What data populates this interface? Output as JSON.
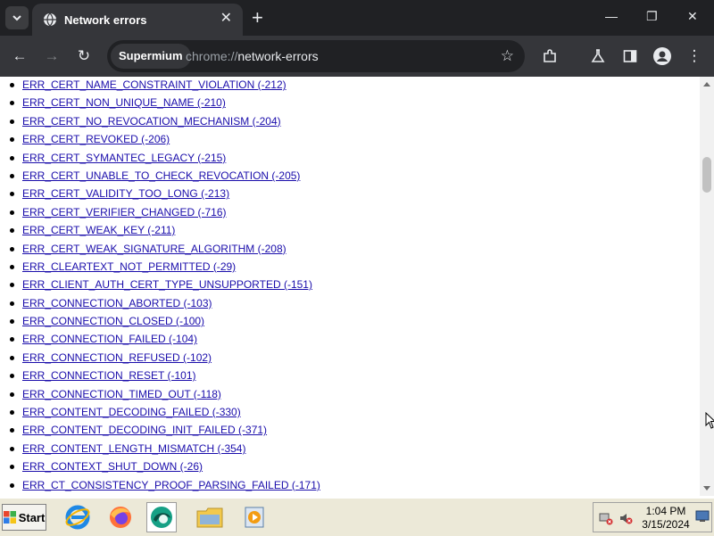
{
  "tab": {
    "title": "Network errors",
    "close_glyph": "✕"
  },
  "window": {
    "minimize_glyph": "—",
    "restore_glyph": "❐",
    "close_glyph": "✕",
    "new_tab_glyph": "+"
  },
  "toolbar": {
    "back_glyph": "←",
    "forward_glyph": "→",
    "reload_glyph": "↻",
    "site_chip": "Supermium",
    "url_scheme": "chrome://",
    "url_host": "network-errors",
    "bookmark_glyph": "☆",
    "menu_glyph": "⋮"
  },
  "errors": [
    "ERR_CERT_NAME_CONSTRAINT_VIOLATION (-212)",
    "ERR_CERT_NON_UNIQUE_NAME (-210)",
    "ERR_CERT_NO_REVOCATION_MECHANISM (-204)",
    "ERR_CERT_REVOKED (-206)",
    "ERR_CERT_SYMANTEC_LEGACY (-215)",
    "ERR_CERT_UNABLE_TO_CHECK_REVOCATION (-205)",
    "ERR_CERT_VALIDITY_TOO_LONG (-213)",
    "ERR_CERT_VERIFIER_CHANGED (-716)",
    "ERR_CERT_WEAK_KEY (-211)",
    "ERR_CERT_WEAK_SIGNATURE_ALGORITHM (-208)",
    "ERR_CLEARTEXT_NOT_PERMITTED (-29)",
    "ERR_CLIENT_AUTH_CERT_TYPE_UNSUPPORTED (-151)",
    "ERR_CONNECTION_ABORTED (-103)",
    "ERR_CONNECTION_CLOSED (-100)",
    "ERR_CONNECTION_FAILED (-104)",
    "ERR_CONNECTION_REFUSED (-102)",
    "ERR_CONNECTION_RESET (-101)",
    "ERR_CONNECTION_TIMED_OUT (-118)",
    "ERR_CONTENT_DECODING_FAILED (-330)",
    "ERR_CONTENT_DECODING_INIT_FAILED (-371)",
    "ERR_CONTENT_LENGTH_MISMATCH (-354)",
    "ERR_CONTEXT_SHUT_DOWN (-26)",
    "ERR_CT_CONSISTENCY_PROOF_PARSING_FAILED (-171)"
  ],
  "taskbar": {
    "start_label": "Start",
    "apps": [
      "internet-explorer",
      "firefox",
      "supermium-browser",
      "file-explorer",
      "media-player"
    ],
    "clock_time": "1:04 PM",
    "clock_date": "3/15/2024"
  },
  "colors": {
    "link": "#1a0dab",
    "tabstrip": "#202124",
    "toolbar": "#35363a",
    "taskbar": "#ece9d8"
  }
}
